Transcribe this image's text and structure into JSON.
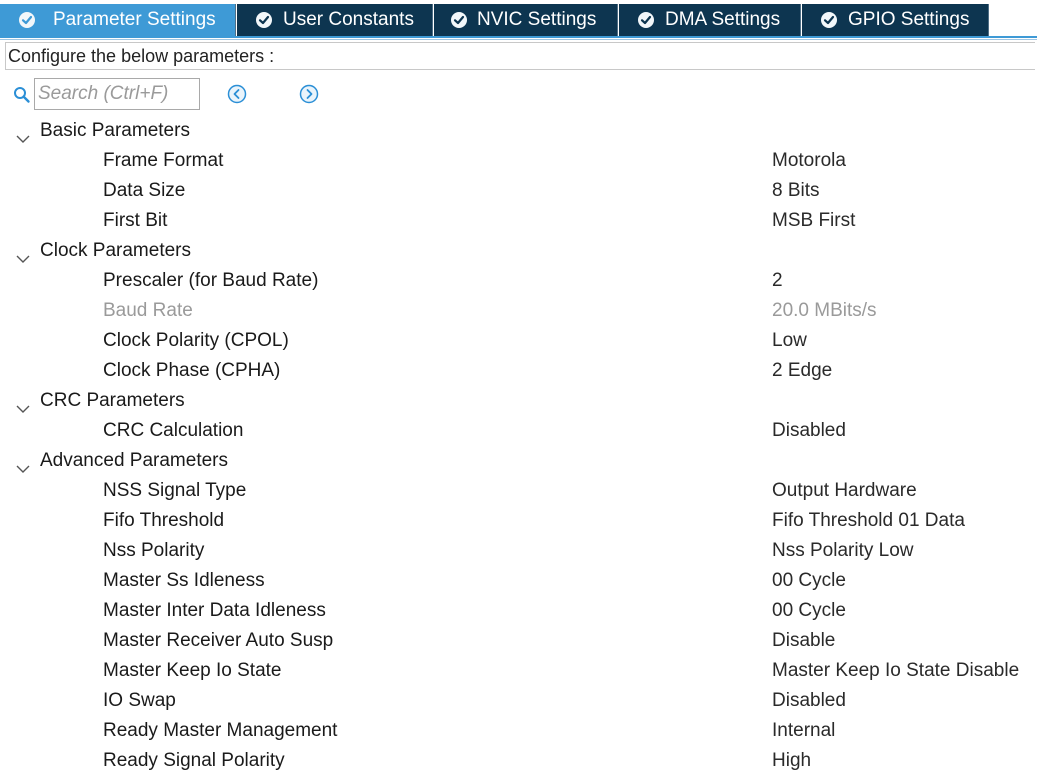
{
  "tabs": [
    {
      "label": "Parameter Settings",
      "active": true
    },
    {
      "label": "User Constants",
      "active": false
    },
    {
      "label": "NVIC Settings",
      "active": false
    },
    {
      "label": "DMA Settings",
      "active": false
    },
    {
      "label": "GPIO Settings",
      "active": false
    }
  ],
  "config_header": "Configure the below parameters :",
  "search": {
    "placeholder": "Search (Ctrl+F)",
    "value": ""
  },
  "colors": {
    "active_tab": "#3e9ad6",
    "tab": "#0d3550",
    "accent_icon": "#2b8fd6"
  },
  "groups": [
    {
      "label": "Basic Parameters",
      "params": [
        {
          "name": "Frame Format",
          "value": "Motorola"
        },
        {
          "name": "Data Size",
          "value": "8 Bits"
        },
        {
          "name": "First Bit",
          "value": "MSB First"
        }
      ]
    },
    {
      "label": "Clock Parameters",
      "params": [
        {
          "name": "Prescaler (for Baud Rate)",
          "value": "2"
        },
        {
          "name": "Baud Rate",
          "value": "20.0 MBits/s",
          "disabled": true
        },
        {
          "name": "Clock Polarity (CPOL)",
          "value": "Low"
        },
        {
          "name": "Clock Phase (CPHA)",
          "value": "2 Edge"
        }
      ]
    },
    {
      "label": "CRC Parameters",
      "params": [
        {
          "name": "CRC Calculation",
          "value": "Disabled"
        }
      ]
    },
    {
      "label": "Advanced Parameters",
      "params": [
        {
          "name": "NSS Signal Type",
          "value": "Output Hardware"
        },
        {
          "name": "Fifo Threshold",
          "value": "Fifo Threshold 01 Data"
        },
        {
          "name": "Nss Polarity",
          "value": "Nss Polarity Low"
        },
        {
          "name": "Master Ss Idleness",
          "value": "00 Cycle"
        },
        {
          "name": "Master Inter Data Idleness",
          "value": "00 Cycle"
        },
        {
          "name": "Master Receiver Auto Susp",
          "value": "Disable"
        },
        {
          "name": "Master Keep Io State",
          "value": "Master Keep Io State Disable"
        },
        {
          "name": "IO Swap",
          "value": "Disabled"
        },
        {
          "name": "Ready Master Management",
          "value": "Internal"
        },
        {
          "name": "Ready Signal Polarity",
          "value": "High"
        }
      ]
    }
  ]
}
